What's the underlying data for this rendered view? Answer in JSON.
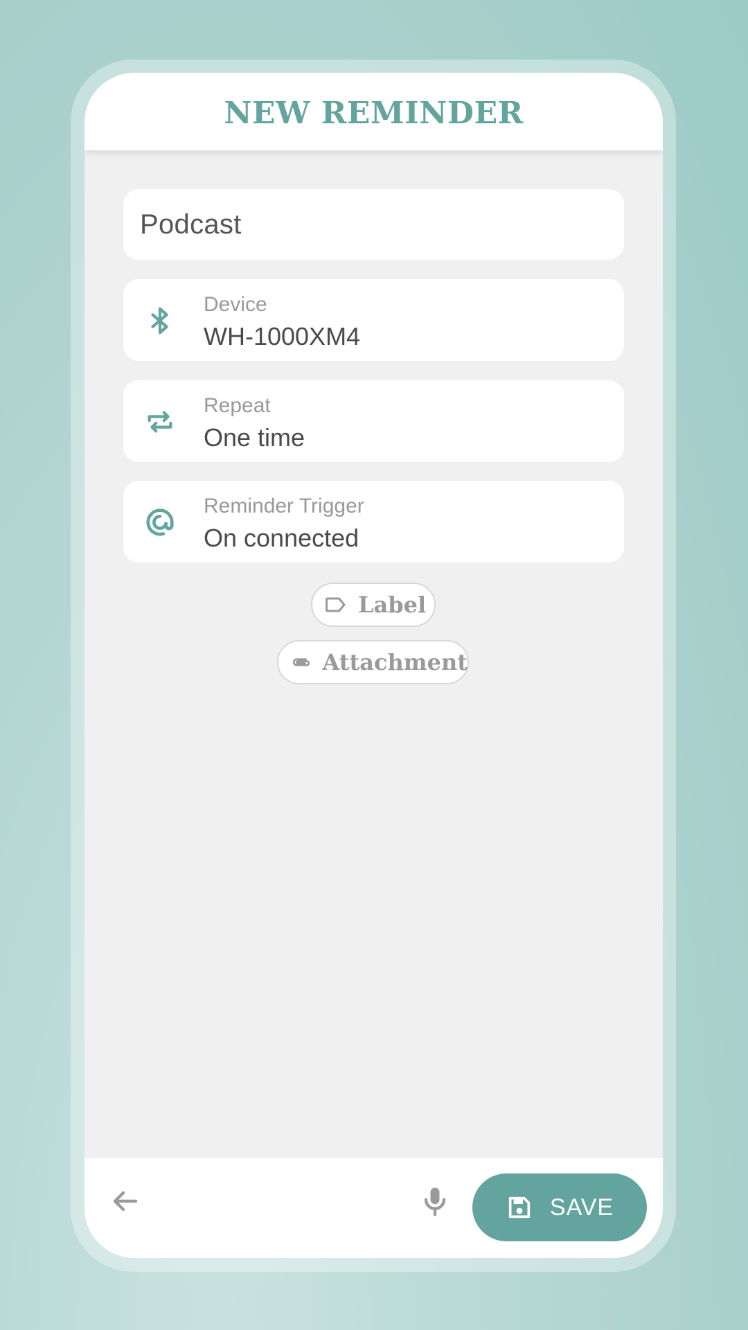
{
  "header": {
    "title": "NEW REMINDER"
  },
  "reminder": {
    "title": "Podcast"
  },
  "fields": [
    {
      "label": "Device",
      "value": "WH-1000XM4",
      "icon": "bluetooth-icon"
    },
    {
      "label": "Repeat",
      "value": "One time",
      "icon": "repeat-icon"
    },
    {
      "label": "Reminder Trigger",
      "value": "On connected",
      "icon": "trigger-target-icon"
    }
  ],
  "chips": {
    "label": {
      "text": "Label",
      "icon": "tag-icon"
    },
    "attachment": {
      "text": "Attachment",
      "icon": "paperclip-icon"
    }
  },
  "bottom_bar": {
    "save_label": "SAVE",
    "back_icon": "arrow-left-icon",
    "mic_icon": "microphone-icon",
    "save_icon": "floppy-disk-icon"
  },
  "colors": {
    "accent": "#63a59e",
    "screen_background": "#f0f0f0",
    "card_background": "#ffffff",
    "label_gray": "#999999",
    "value_gray": "#4a4a4a"
  }
}
